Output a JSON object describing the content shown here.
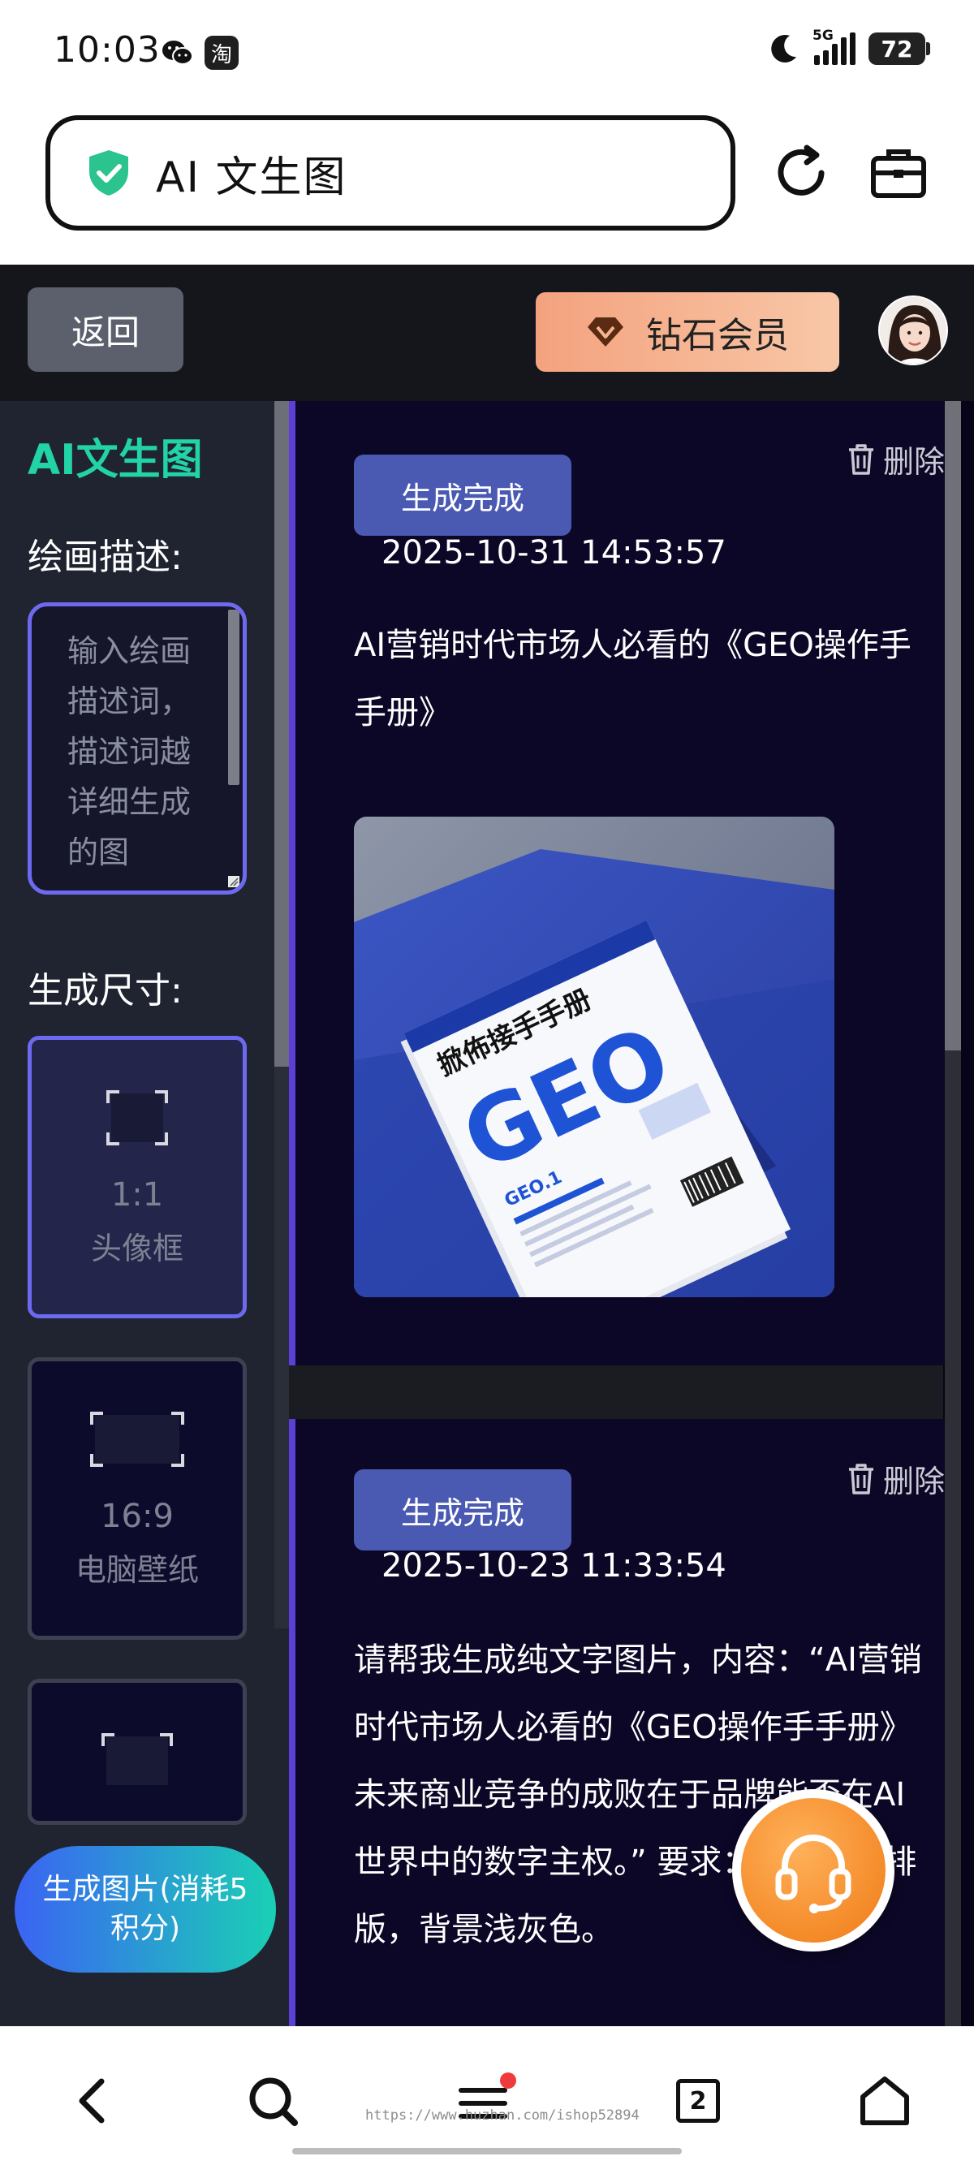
{
  "status_bar": {
    "time": "10:03",
    "notif_icons": [
      "wechat-icon",
      "taobao-icon"
    ],
    "taobao_glyph": "淘",
    "network_label": "5G",
    "battery": "72"
  },
  "browser": {
    "url_title": "AI 文生图",
    "security_icon": "shield-check-icon",
    "tab_count": "2",
    "watermark": "https://www.huzhan.com/ishop52894"
  },
  "app": {
    "back_label": "返回",
    "vip_label": "钻石会员",
    "brand_title": "AI文生图",
    "describe_label": "绘画描述:",
    "prompt_placeholder": "输入绘画描述词，描述词越详细生成的图",
    "size_label": "生成尺寸:",
    "sizes": [
      {
        "ratio": "1:1",
        "name": "头像框"
      },
      {
        "ratio": "16:9",
        "name": "电脑壁纸"
      },
      {
        "ratio": "",
        "name": ""
      }
    ],
    "generate_button": "生成图片(消耗5积分)",
    "delete_label": "删除",
    "colors": {
      "accent": "#6e6af0",
      "brand": "#23d3a8",
      "chip": "#4a5ab3",
      "vip": "#f4a27e"
    }
  },
  "records": [
    {
      "status": "生成完成",
      "time": "2025-10-31 14:53:57",
      "prompt": "AI营销时代市场人必看的《GEO操作手手册》",
      "image": {
        "cover_title": "掀佈接手手册",
        "cover_big": "GEO",
        "cover_sub": "GEO.1"
      }
    },
    {
      "status": "生成完成",
      "time": "2025-10-23 11:33:54",
      "prompt": "请帮我生成纯文字图片，内容：“AI营销时代市场人必看的《GEO操作手手册》 未来商业竞争的成败在于品牌能否在AI世界中的数字主权。” 要求：简单文字排版，背景浅灰色。"
    }
  ]
}
